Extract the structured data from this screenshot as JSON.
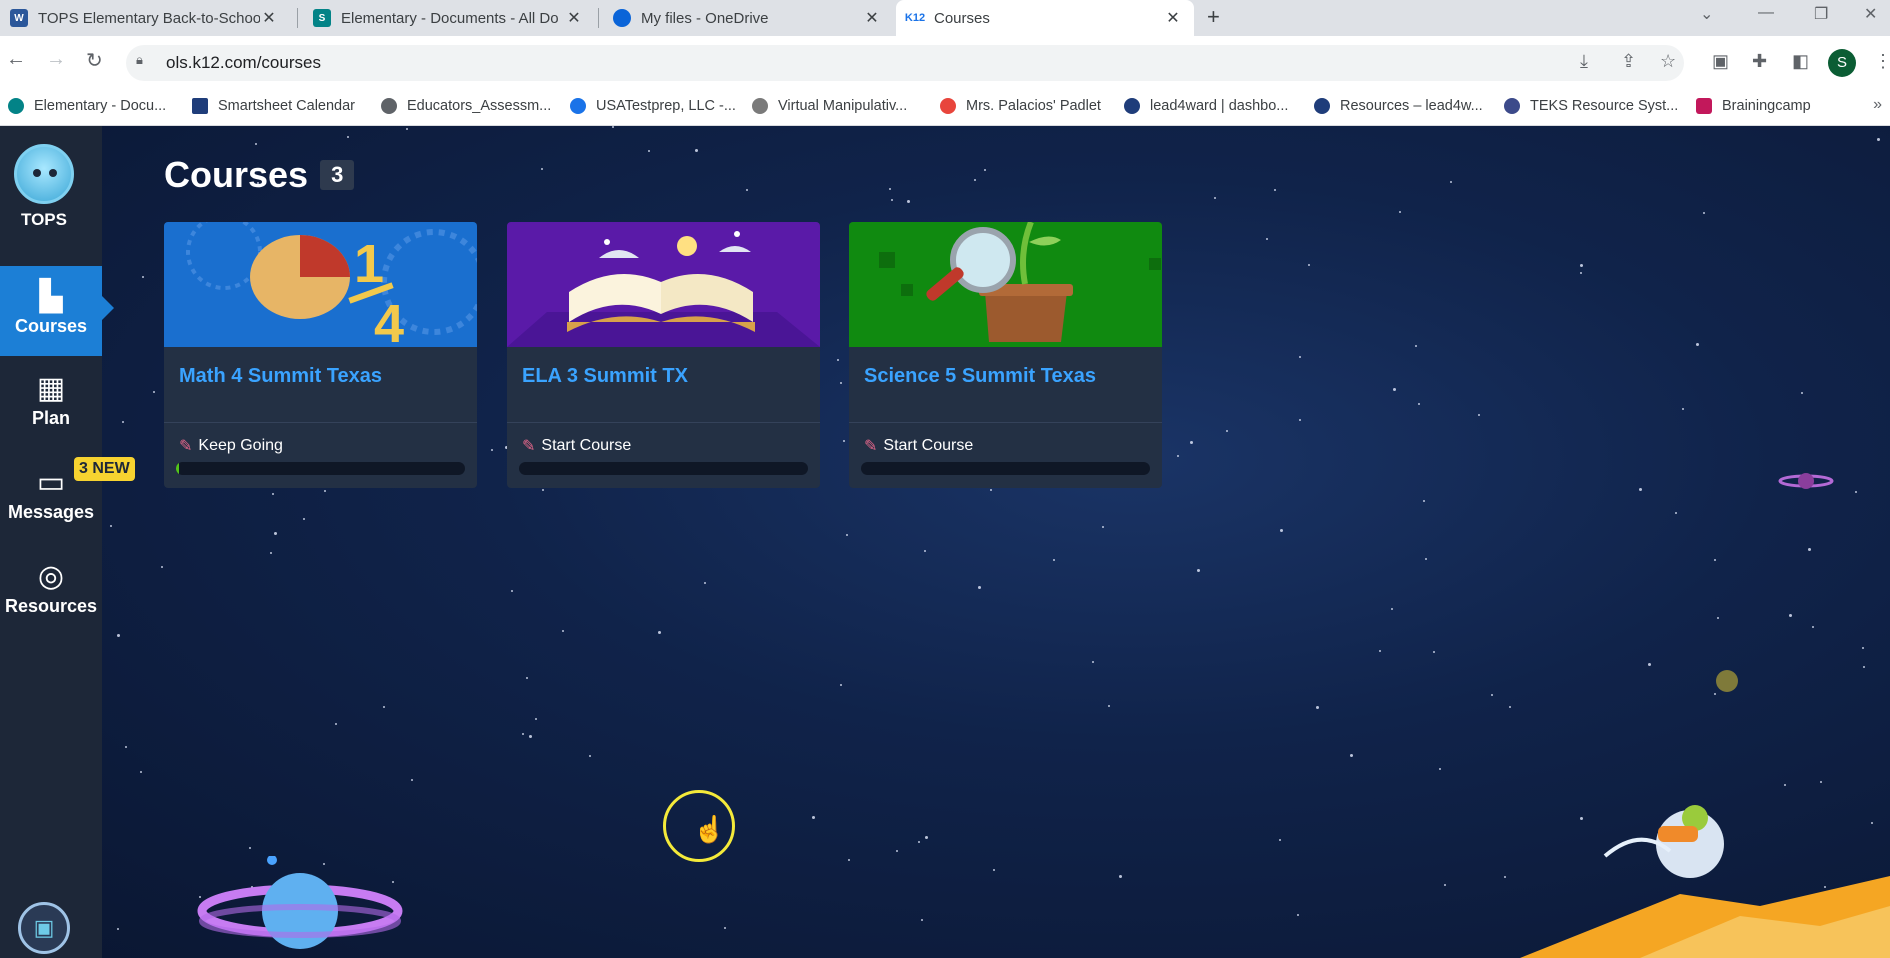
{
  "browser": {
    "tabs": [
      {
        "title": "TOPS Elementary Back-to-School",
        "favicon_color": "#2b579a",
        "active": false
      },
      {
        "title": "Elementary - Documents - All Do",
        "favicon_color": "#038387",
        "active": false
      },
      {
        "title": "My files - OneDrive",
        "favicon_color": "#0a64d8",
        "active": false
      },
      {
        "title": "Courses",
        "favicon_color": "#1a73e8",
        "active": true
      }
    ],
    "new_tab": "+",
    "url": "ols.k12.com/courses",
    "profile_initial": "S",
    "bookmarks": [
      {
        "label": "Elementary - Docu...",
        "color": "#038387"
      },
      {
        "label": "Smartsheet Calendar",
        "color": "#1f3d7a"
      },
      {
        "label": "Educators_Assessm...",
        "color": "#5f6368"
      },
      {
        "label": "USATestprep, LLC -...",
        "color": "#1a73e8"
      },
      {
        "label": "Virtual Manipulativ...",
        "color": "#7a7a7a"
      },
      {
        "label": "Mrs. Palacios' Padlet",
        "color": "#e8453c"
      },
      {
        "label": "lead4ward | dashbo...",
        "color": "#1f3d7a"
      },
      {
        "label": "Resources – lead4w...",
        "color": "#1f3d7a"
      },
      {
        "label": "TEKS Resource Syst...",
        "color": "#3c4a8a"
      },
      {
        "label": "Brainingcamp",
        "color": "#c2185b"
      }
    ]
  },
  "sidebar": {
    "logo_label": "TOPS",
    "items": [
      {
        "label": "Courses",
        "icon": "book-icon",
        "active": true
      },
      {
        "label": "Plan",
        "icon": "calendar-check-icon",
        "active": false
      },
      {
        "label": "Messages",
        "icon": "chat-bubble-icon",
        "active": false
      },
      {
        "label": "Resources",
        "icon": "globe-icon",
        "active": false
      }
    ],
    "messages_badge": "3 NEW"
  },
  "main": {
    "title": "Courses",
    "count": "3",
    "courses": [
      {
        "title": "Math 4 Summit Texas",
        "status": "Keep Going",
        "progress": 0.01,
        "banner_color": "#1a6fcf",
        "image": "pie-fraction-icon"
      },
      {
        "title": "ELA 3 Summit TX",
        "status": "Start Course",
        "progress": 0,
        "banner_color": "#5a1aa8",
        "image": "open-book-icon"
      },
      {
        "title": "Science 5 Summit Texas",
        "status": "Start Course",
        "progress": 0,
        "banner_color": "#108a10",
        "image": "magnifier-plant-icon"
      }
    ]
  },
  "colors": {
    "accent": "#1c7fd6",
    "course_title": "#3aa3ff",
    "badge": "#f7d330",
    "background": "#0c1c3a"
  }
}
